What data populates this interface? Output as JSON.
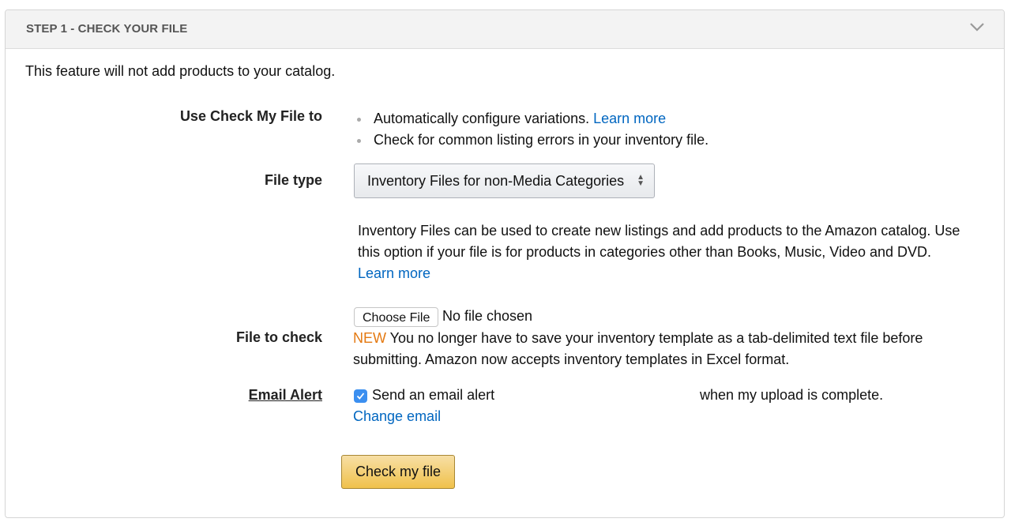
{
  "panel": {
    "title": "STEP 1 - CHECK YOUR FILE",
    "collapse_icon": "chevron-down-icon"
  },
  "intro": "This feature will not add products to your catalog.",
  "use_check": {
    "label": "Use Check My File to",
    "items": [
      {
        "text": "Automatically configure variations. ",
        "link": "Learn more"
      },
      {
        "text": "Check for common listing errors in your inventory file.",
        "link": ""
      }
    ]
  },
  "file_type": {
    "label": "File type",
    "selected": "Inventory Files for non-Media Categories",
    "description": "Inventory Files can be used to create new listings and add products to the Amazon catalog. Use this option if your file is for products in categories other than Books, Music, Video and DVD. ",
    "description_link": "Learn more"
  },
  "file_to_check": {
    "label": "File to check",
    "choose_button": "Choose File",
    "status": "No file chosen",
    "new_badge": "NEW",
    "note": " You no longer have to save your inventory template as a tab-delimited text file before submitting. Amazon now accepts inventory templates in Excel format."
  },
  "email_alert": {
    "label": "Email Alert",
    "checked": true,
    "send_text": "Send an email alert",
    "when_text": "when my upload is complete.",
    "change_link": "Change email"
  },
  "submit_button": "Check my file",
  "colors": {
    "link": "#0066c0",
    "new_badge": "#e47911",
    "primary_button": "#f0c14b",
    "checkbox": "#3b8ff0"
  }
}
